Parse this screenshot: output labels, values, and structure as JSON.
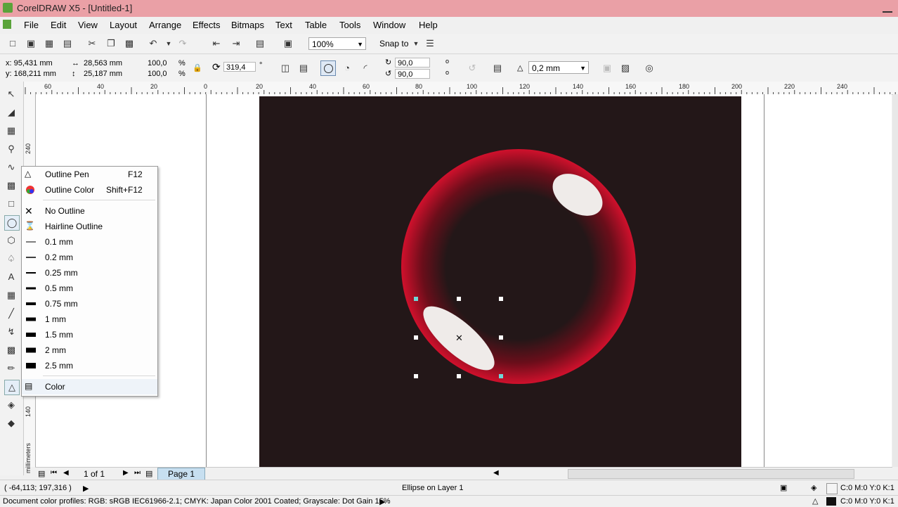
{
  "app": {
    "title": "CorelDRAW X5 - [Untitled-1]"
  },
  "menu": [
    "File",
    "Edit",
    "View",
    "Layout",
    "Arrange",
    "Effects",
    "Bitmaps",
    "Text",
    "Table",
    "Tools",
    "Window",
    "Help"
  ],
  "toolbar": {
    "zoom": "100%",
    "snap_to": "Snap to"
  },
  "propbar": {
    "x": "x: 95,431 mm",
    "y": "y: 168,211 mm",
    "width": "28,563 mm",
    "height": "25,187 mm",
    "scale_x": "100,0",
    "scale_y": "100,0",
    "percent": "%",
    "rotation": "319,4",
    "degree": "°",
    "start_angle": "90,0",
    "end_angle": "90,0",
    "outline_width": "0,2 mm"
  },
  "ruler": {
    "h_labels": [
      "60",
      "40",
      "20",
      "0",
      "20",
      "40",
      "60",
      "80",
      "100",
      "120",
      "140",
      "160",
      "180",
      "200",
      "220",
      "240"
    ],
    "v_labels": [
      "240",
      "140"
    ],
    "units": "millimeters"
  },
  "flyout": {
    "items": [
      {
        "label": "Outline Pen",
        "shortcut": "F12"
      },
      {
        "label": "Outline Color",
        "shortcut": "Shift+F12"
      },
      {
        "label": "No Outline",
        "shortcut": ""
      },
      {
        "label": "Hairline Outline",
        "shortcut": ""
      },
      {
        "label": "0.1 mm",
        "shortcut": ""
      },
      {
        "label": "0.2 mm",
        "shortcut": ""
      },
      {
        "label": "0.25 mm",
        "shortcut": ""
      },
      {
        "label": "0.5 mm",
        "shortcut": ""
      },
      {
        "label": "0.75 mm",
        "shortcut": ""
      },
      {
        "label": "1 mm",
        "shortcut": ""
      },
      {
        "label": "1.5 mm",
        "shortcut": ""
      },
      {
        "label": "2 mm",
        "shortcut": ""
      },
      {
        "label": "2.5 mm",
        "shortcut": ""
      },
      {
        "label": "Color",
        "shortcut": ""
      }
    ]
  },
  "pagenav": {
    "count": "1 of 1",
    "tab": "Page 1"
  },
  "status": {
    "coords": "( -64,113; 197,316 )",
    "object": "Ellipse on Layer 1",
    "fill_info": "C:0 M:0 Y:0 K:1",
    "outline_info": "C:0 M:0 Y:0 K:1",
    "profiles": "Document color profiles: RGB: sRGB IEC61966-2.1; CMYK: Japan Color 2001 Coated; Grayscale: Dot Gain 15%"
  },
  "colors": {
    "artboard": "#231718",
    "bubble_red": "#c8102e",
    "titlebar": "#eaa0a6",
    "handle_cyan": "#5fd0d0"
  }
}
